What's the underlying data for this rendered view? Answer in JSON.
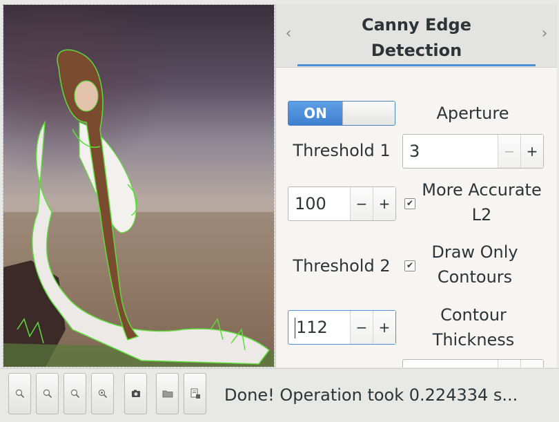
{
  "panel": {
    "title_line1": "Canny Edge",
    "title_line2": "Detection",
    "prev_arrow": "‹",
    "next_arrow": "›"
  },
  "controls": {
    "toggle_label": "ON",
    "aperture_label": "Aperture",
    "aperture_value": "3",
    "threshold1_label": "Threshold 1",
    "threshold1_value": "100",
    "more_accurate_line1": "More Accurate",
    "more_accurate_line2": "L2",
    "more_accurate_checked": true,
    "threshold2_label": "Threshold 2",
    "threshold2_value": "112",
    "draw_only_line1": "Draw Only",
    "draw_only_line2": "Contours",
    "draw_only_checked": true,
    "contour_thickness_line1": "Contour",
    "contour_thickness_line2": "Thickness",
    "minus": "−",
    "plus": "+",
    "check_mark": "✔"
  },
  "toolbar": {
    "buttons": [
      "zoom-in-icon",
      "zoom-out-icon",
      "zoom-fit-icon",
      "zoom-original-icon",
      "snapshot-icon",
      "open-folder-icon",
      "save-as-icon"
    ],
    "status": "Done! Operation took 0.224334 s..."
  },
  "colors": {
    "accent": "#4a90d9",
    "edge_overlay": "#5ddc3a"
  }
}
